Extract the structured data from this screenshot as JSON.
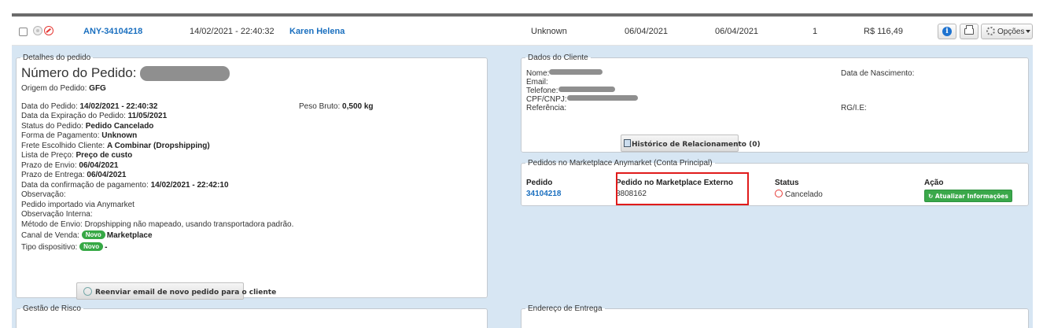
{
  "order_row": {
    "order_id": "ANY-34104218",
    "datetime": "14/02/2021 - 22:40:32",
    "customer": "Karen Helena",
    "payment": "Unknown",
    "date_1": "06/04/2021",
    "date_2": "06/04/2021",
    "quantity": "1",
    "total": "R$ 116,49",
    "options_label": "Opções"
  },
  "details": {
    "legend": "Detalhes do pedido",
    "number_label": "Número do Pedido:",
    "origin_label": "Origem do Pedido:",
    "origin_value": "GFG",
    "order_date_label": "Data do Pedido:",
    "order_date_value": "14/02/2021 - 22:40:32",
    "weight_label": "Peso Bruto:",
    "weight_value": "0,500 kg",
    "expiry_label": "Data da Expiração do Pedido:",
    "expiry_value": "11/05/2021",
    "status_label": "Status do Pedido:",
    "status_value": "Pedido Cancelado",
    "payment_label": "Forma de Pagamento:",
    "payment_value": "Unknown",
    "freight_label": "Frete Escolhido Cliente:",
    "freight_value": "A Combinar (Dropshipping)",
    "price_list_label": "Lista de Preço:",
    "price_list_value": "Preço de custo",
    "ship_deadline_label": "Prazo de Envio:",
    "ship_deadline_value": "06/04/2021",
    "delivery_deadline_label": "Prazo de Entrega:",
    "delivery_deadline_value": "06/04/2021",
    "payment_confirm_label": "Data da confirmação de pagamento:",
    "payment_confirm_value": "14/02/2021 - 22:42:10",
    "note_label": "Observação:",
    "note_value": "Pedido importado via Anymarket",
    "internal_note_label": "Observação Interna:",
    "shipping_method_label": "Método de Envio:",
    "shipping_method_value": "Dropshipping não mapeado, usando transportadora padrão.",
    "channel_label": "Canal de Venda:",
    "channel_badge": "Novo",
    "channel_value": "Marketplace",
    "device_label": "Tipo dispositivo:",
    "device_badge": "Novo",
    "device_value": "-",
    "resend_button": "Reenviar email de novo pedido para o cliente"
  },
  "client": {
    "legend": "Dados do Cliente",
    "name_label": "Nome:",
    "email_label": "Email:",
    "phone_label": "Telefone:",
    "doc_label": "CPF/CNPJ:",
    "ref_label": "Referência:",
    "birth_label": "Data de Nascimento:",
    "rg_label": "RG/I.E:",
    "history_button": "Histórico de Relacionamento (0)"
  },
  "marketplace": {
    "legend": "Pedidos no Marketplace Anymarket (Conta Principal)",
    "col_order": "Pedido",
    "col_external": "Pedido no Marketplace Externo",
    "col_status": "Status",
    "col_action": "Ação",
    "order_value": "34104218",
    "external_value": "8808162",
    "status_value": "Cancelado",
    "action_button": "Atualizar Informações"
  },
  "risk": {
    "legend": "Gestão de Risco"
  },
  "address": {
    "legend": "Endereço de Entrega"
  },
  "colors": {
    "link": "#1a6fbf",
    "green": "#36a845",
    "red_highlight": "#e01b1b",
    "page_bg": "#d7e6f3"
  }
}
